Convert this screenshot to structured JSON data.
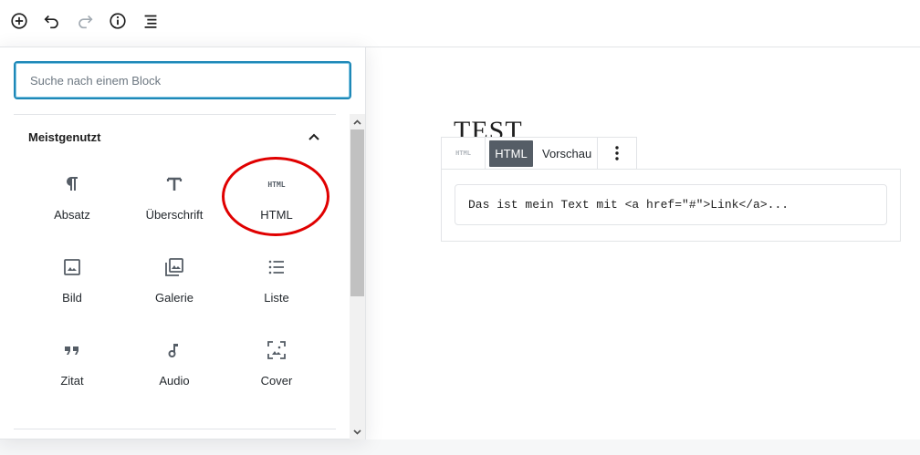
{
  "toolbar": {
    "buttons": [
      {
        "icon": "add-block-icon"
      },
      {
        "icon": "undo-icon"
      },
      {
        "icon": "redo-icon"
      },
      {
        "icon": "info-icon"
      },
      {
        "icon": "block-navigation-icon"
      }
    ]
  },
  "inserter": {
    "search": {
      "placeholder": "Suche nach einem Block"
    },
    "section_title": "Meistgenutzt",
    "blocks": [
      {
        "label": "Absatz",
        "icon": "paragraph-icon"
      },
      {
        "label": "Überschrift",
        "icon": "heading-icon"
      },
      {
        "label": "HTML",
        "icon": "html-icon"
      },
      {
        "label": "Bild",
        "icon": "image-icon"
      },
      {
        "label": "Galerie",
        "icon": "gallery-icon"
      },
      {
        "label": "Liste",
        "icon": "list-icon"
      },
      {
        "label": "Zitat",
        "icon": "quote-icon"
      },
      {
        "label": "Audio",
        "icon": "audio-icon"
      },
      {
        "label": "Cover",
        "icon": "cover-icon"
      }
    ],
    "html_icon_text": "HTML"
  },
  "editor": {
    "post_title": "TEST",
    "block_toolbar": {
      "icon_text": "HTML",
      "tab_html": "HTML",
      "tab_preview": "Vorschau"
    },
    "code": "Das ist mein Text mit <a href=\"#\">Link</a>..."
  },
  "colors": {
    "accent": "#1e88b7",
    "highlight": "#e00000",
    "active_tab": "#555d66"
  }
}
